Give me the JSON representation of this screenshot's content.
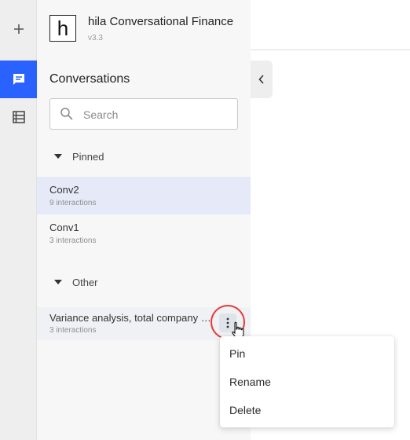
{
  "rail": {
    "items": [
      {
        "icon": "plus-icon",
        "active": false
      },
      {
        "icon": "chat-icon",
        "active": true
      },
      {
        "icon": "table-list-icon",
        "active": false
      }
    ],
    "accent": "#2962ff"
  },
  "app": {
    "logo_letter": "h",
    "title": "hila Conversational Finance",
    "version": "v3.3"
  },
  "sidebar": {
    "heading": "Conversations",
    "search_placeholder": "Search",
    "sections": [
      {
        "label": "Pinned",
        "items": [
          {
            "name": "Conv2",
            "count": "9 interactions",
            "selected": true
          },
          {
            "name": "Conv1",
            "count": "3 interactions",
            "selected": false
          }
        ]
      },
      {
        "label": "Other",
        "items": [
          {
            "name": "Variance analysis, total company a...",
            "count": "3 interactions",
            "selected": false
          }
        ]
      }
    ]
  },
  "context_menu": {
    "items": [
      "Pin",
      "Rename",
      "Delete"
    ]
  },
  "colors": {
    "selected_row": "#e6eaf8",
    "highlight_ring": "#e53935"
  }
}
